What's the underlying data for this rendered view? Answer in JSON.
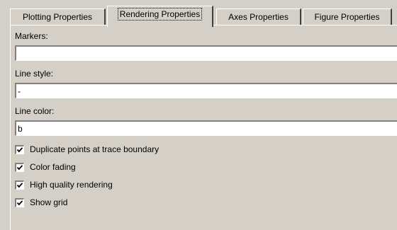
{
  "tabs": [
    {
      "label": "Plotting Properties",
      "active": false
    },
    {
      "label": "Rendering Properties",
      "active": true
    },
    {
      "label": "Axes Properties",
      "active": false
    },
    {
      "label": "Figure Properties",
      "active": false
    }
  ],
  "fields": {
    "markers": {
      "label": "Markers:",
      "value": ""
    },
    "line_style": {
      "label": "Line style:",
      "value": "-"
    },
    "line_color": {
      "label": "Line color:",
      "value": "b"
    }
  },
  "checkboxes": [
    {
      "label": "Duplicate points at trace boundary",
      "checked": true
    },
    {
      "label": "Color fading",
      "checked": true
    },
    {
      "label": "High quality rendering",
      "checked": true
    },
    {
      "label": "Show grid",
      "checked": true
    }
  ],
  "colors": {
    "face": "#d4d0c8",
    "highlight": "#ffffff",
    "shadow": "#808080",
    "dark_shadow": "#404040"
  }
}
